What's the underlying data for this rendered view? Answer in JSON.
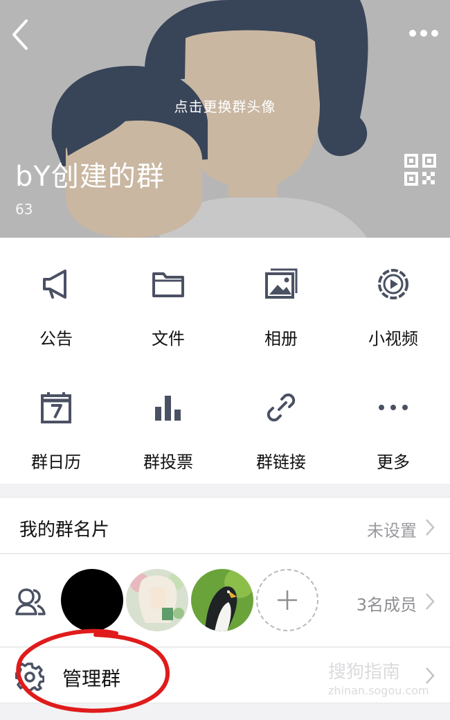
{
  "header": {
    "change_avatar_hint": "点击更换群头像",
    "group_name": "bY创建的群",
    "group_id": "63",
    "icons": [
      "back-chevron-icon",
      "more-dots-icon",
      "qr-code-icon"
    ]
  },
  "grid": [
    {
      "label": "公告",
      "icon": "megaphone-icon"
    },
    {
      "label": "文件",
      "icon": "folder-icon"
    },
    {
      "label": "相册",
      "icon": "photo-album-icon"
    },
    {
      "label": "小视频",
      "icon": "video-play-icon"
    },
    {
      "label": "群日历",
      "icon": "calendar-icon"
    },
    {
      "label": "群投票",
      "icon": "bar-chart-icon"
    },
    {
      "label": "群链接",
      "icon": "link-icon"
    },
    {
      "label": "更多",
      "icon": "more-dots-icon"
    }
  ],
  "card": {
    "title": "我的群名片",
    "value": "未设置"
  },
  "members": {
    "count_label": "3名成员"
  },
  "manage": {
    "label": "管理群"
  },
  "watermark": {
    "text": "搜狗指南",
    "sub": "zhinan.sogou.com"
  },
  "colors": {
    "icon": "#4a5163",
    "header_bg": "#b6b6b7",
    "hair": "#384458",
    "skin": "#c9b7a2",
    "annotation": "#e01b1b"
  }
}
